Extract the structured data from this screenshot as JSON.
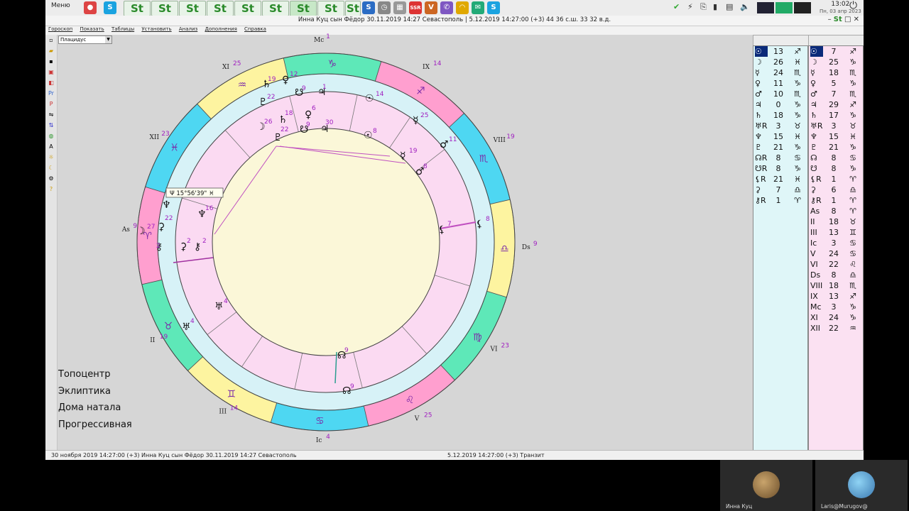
{
  "taskbar": {
    "menu_label": "Меню",
    "st_label": "St",
    "clock_time": "13:02",
    "clock_date": "Пн, 03 апр 2023"
  },
  "window": {
    "title": "Инна Куц сын Фёдор 30.11.2019 14:27 Севастополь |    5.12.2019 14:27:00 (+3)   44 36 с.ш. 33 32 в.д.",
    "menu": [
      "Гороскоп",
      "Показать",
      "Таблицы",
      "Установить",
      "Анализ",
      "Дополнения",
      "Справка"
    ],
    "house_system": "Плацидус"
  },
  "chart_labels": [
    "Топоцентр",
    "Эклиптика",
    "Дома натала",
    "Прогрессивная"
  ],
  "tooltip": "Ψ  15°56'39\"  ♓",
  "houses_outer": [
    {
      "name": "Mc",
      "deg": "1"
    },
    {
      "name": "IX",
      "deg": "14"
    },
    {
      "name": "VIII",
      "deg": "19"
    },
    {
      "name": "Ds",
      "deg": "9"
    },
    {
      "name": "VI",
      "deg": "23"
    },
    {
      "name": "V",
      "deg": "25"
    },
    {
      "name": "Ic",
      "deg": "4"
    },
    {
      "name": "III",
      "deg": "14"
    },
    {
      "name": "II",
      "deg": "19"
    },
    {
      "name": "As",
      "deg": "9"
    },
    {
      "name": "XII",
      "deg": "23"
    },
    {
      "name": "XI",
      "deg": "25"
    }
  ],
  "table_left": [
    {
      "g": "☉",
      "d": "13",
      "z": "♐"
    },
    {
      "g": "☽",
      "d": "26",
      "z": "♓"
    },
    {
      "g": "☿",
      "d": "24",
      "z": "♏"
    },
    {
      "g": "♀",
      "d": "11",
      "z": "♑"
    },
    {
      "g": "♂",
      "d": "10",
      "z": "♏"
    },
    {
      "g": "♃",
      "d": "0",
      "z": "♑"
    },
    {
      "g": "♄",
      "d": "18",
      "z": "♑"
    },
    {
      "g": "♅R",
      "d": "3",
      "z": "♉"
    },
    {
      "g": "♆",
      "d": "15",
      "z": "♓"
    },
    {
      "g": "♇",
      "d": "21",
      "z": "♑"
    },
    {
      "g": "☊R",
      "d": "8",
      "z": "♋"
    },
    {
      "g": "☋R",
      "d": "8",
      "z": "♑"
    },
    {
      "g": "⚸R",
      "d": "21",
      "z": "♓"
    },
    {
      "g": "⚳",
      "d": "7",
      "z": "♎"
    },
    {
      "g": "⚷R",
      "d": "1",
      "z": "♈"
    }
  ],
  "table_right": [
    {
      "g": "☉",
      "d": "7",
      "z": "♐"
    },
    {
      "g": "☽",
      "d": "25",
      "z": "♑"
    },
    {
      "g": "☿",
      "d": "18",
      "z": "♏"
    },
    {
      "g": "♀",
      "d": "5",
      "z": "♑"
    },
    {
      "g": "♂",
      "d": "7",
      "z": "♏"
    },
    {
      "g": "♃",
      "d": "29",
      "z": "♐"
    },
    {
      "g": "♄",
      "d": "17",
      "z": "♑"
    },
    {
      "g": "♅R",
      "d": "3",
      "z": "♉"
    },
    {
      "g": "♆",
      "d": "15",
      "z": "♓"
    },
    {
      "g": "♇",
      "d": "21",
      "z": "♑"
    },
    {
      "g": "☊",
      "d": "8",
      "z": "♋"
    },
    {
      "g": "☋",
      "d": "8",
      "z": "♑"
    },
    {
      "g": "⚸R",
      "d": "1",
      "z": "♈"
    },
    {
      "g": "⚳",
      "d": "6",
      "z": "♎"
    },
    {
      "g": "⚷R",
      "d": "1",
      "z": "♈"
    },
    {
      "g": "As",
      "d": "8",
      "z": "♈"
    },
    {
      "g": "II",
      "d": "18",
      "z": "♉"
    },
    {
      "g": "III",
      "d": "13",
      "z": "♊"
    },
    {
      "g": "Ic",
      "d": "3",
      "z": "♋"
    },
    {
      "g": "V",
      "d": "24",
      "z": "♋"
    },
    {
      "g": "VI",
      "d": "22",
      "z": "♌"
    },
    {
      "g": "Ds",
      "d": "8",
      "z": "♎"
    },
    {
      "g": "VIII",
      "d": "18",
      "z": "♏"
    },
    {
      "g": "IX",
      "d": "13",
      "z": "♐"
    },
    {
      "g": "Mc",
      "d": "3",
      "z": "♑"
    },
    {
      "g": "XI",
      "d": "24",
      "z": "♑"
    },
    {
      "g": "XII",
      "d": "22",
      "z": "♒"
    }
  ],
  "status": {
    "left": "30 ноября 2019  14:27:00 (+3)    Инна Куц сын Фёдор 30.11.2019 14:27 Севастополь",
    "right": "5.12.2019 14:27:00 (+3)  Транзит"
  },
  "participants": [
    {
      "name": "Инна Куц"
    },
    {
      "name": "Laris@Murugov@"
    }
  ]
}
